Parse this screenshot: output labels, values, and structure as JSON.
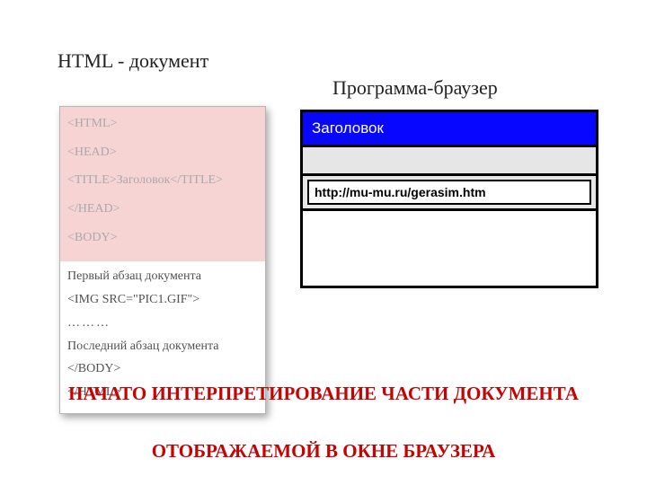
{
  "headings": {
    "left": "HTML - документ",
    "right": "Программа-браузер"
  },
  "code": {
    "l1": "<HTML>",
    "l2": "<HEAD>",
    "l3": "<TITLE>Заголовок</TITLE>",
    "l4": "</HEAD>",
    "l5": "<BODY>",
    "l6": "Первый абзац документа",
    "l7": "<IMG SRC=\"PIC1.GIF\">",
    "l8": "………",
    "l9": "Последний абзац документа",
    "l10": "</BODY>",
    "l11": "</HTML>"
  },
  "browser": {
    "title": "Заголовок",
    "url": "http://mu-mu.ru/gerasim.htm"
  },
  "caption": {
    "line1": "НАЧАТО ИНТЕРПРЕТИРОВАНИЕ ЧАСТИ ДОКУМЕНТА",
    "line2": "ОТОБРАЖАЕМОЙ В ОКНЕ БРАУЗЕРА"
  }
}
